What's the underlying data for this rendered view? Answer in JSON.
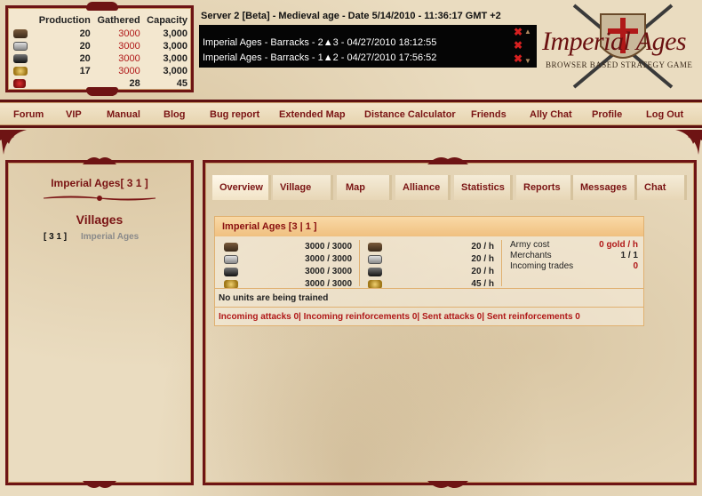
{
  "resources": {
    "headers": [
      "Production",
      "Gathered",
      "Capacity"
    ],
    "rows": [
      {
        "icon": "wood-icon",
        "production": "20",
        "gathered": "3000",
        "capacity": "3,000"
      },
      {
        "icon": "stone-icon",
        "production": "20",
        "gathered": "3000",
        "capacity": "3,000"
      },
      {
        "icon": "iron-icon",
        "production": "20",
        "gathered": "3000",
        "capacity": "3,000"
      },
      {
        "icon": "gold-icon",
        "production": "17",
        "gathered": "3000",
        "capacity": "3,000"
      },
      {
        "icon": "food-icon",
        "production": "",
        "gathered": "28",
        "capacity": "45"
      }
    ]
  },
  "server_info": "Server 2 [Beta] - Medieval age - Date 5/14/2010 - 11:36:17 GMT +2",
  "news": [
    {
      "text": "Imperial Ages - Barracks - 2▲3 - 04/27/2010 18:12:55"
    },
    {
      "text": "Imperial Ages - Barracks - 1▲2 - 04/27/2010 17:56:52"
    }
  ],
  "logo": {
    "title": "Imperial Ages",
    "subtitle": "BROWSER BASED STRATEGY GAME"
  },
  "nav": [
    "Forum",
    "VIP",
    "Manual",
    "Blog",
    "Bug report",
    "Extended Map",
    "Distance Calculator",
    "Friends",
    "Ally Chat",
    "Profile",
    "Log Out"
  ],
  "left": {
    "player_title": "Imperial Ages[ 3 1 ]",
    "villages_heading": "Villages",
    "village_coords": "[ 3 1 ]",
    "village_name": "Imperial Ages"
  },
  "tabs": [
    "Overview",
    "Village",
    "Map",
    "Alliance",
    "Statistics",
    "Reports",
    "Messages",
    "Chat"
  ],
  "overview": {
    "header": "Imperial Ages [3 | 1 ]",
    "storage": [
      "3000 / 3000",
      "3000 / 3000",
      "3000 / 3000",
      "3000 / 3000"
    ],
    "rates": [
      "20 / h",
      "20 / h",
      "20 / h",
      "45 / h"
    ],
    "info": [
      {
        "label": "Army cost",
        "value": "0 gold / h"
      },
      {
        "label": "Merchants",
        "value": "1 / 1"
      },
      {
        "label": "Incoming trades",
        "value": "0"
      }
    ],
    "training": "No units are being trained",
    "attacks": "Incoming attacks 0| Incoming reinforcements 0| Sent attacks 0| Sent reinforcements 0"
  },
  "colors": {
    "accent": "#7a1414",
    "border": "#6e1414",
    "header_bg": "#f0c080"
  }
}
